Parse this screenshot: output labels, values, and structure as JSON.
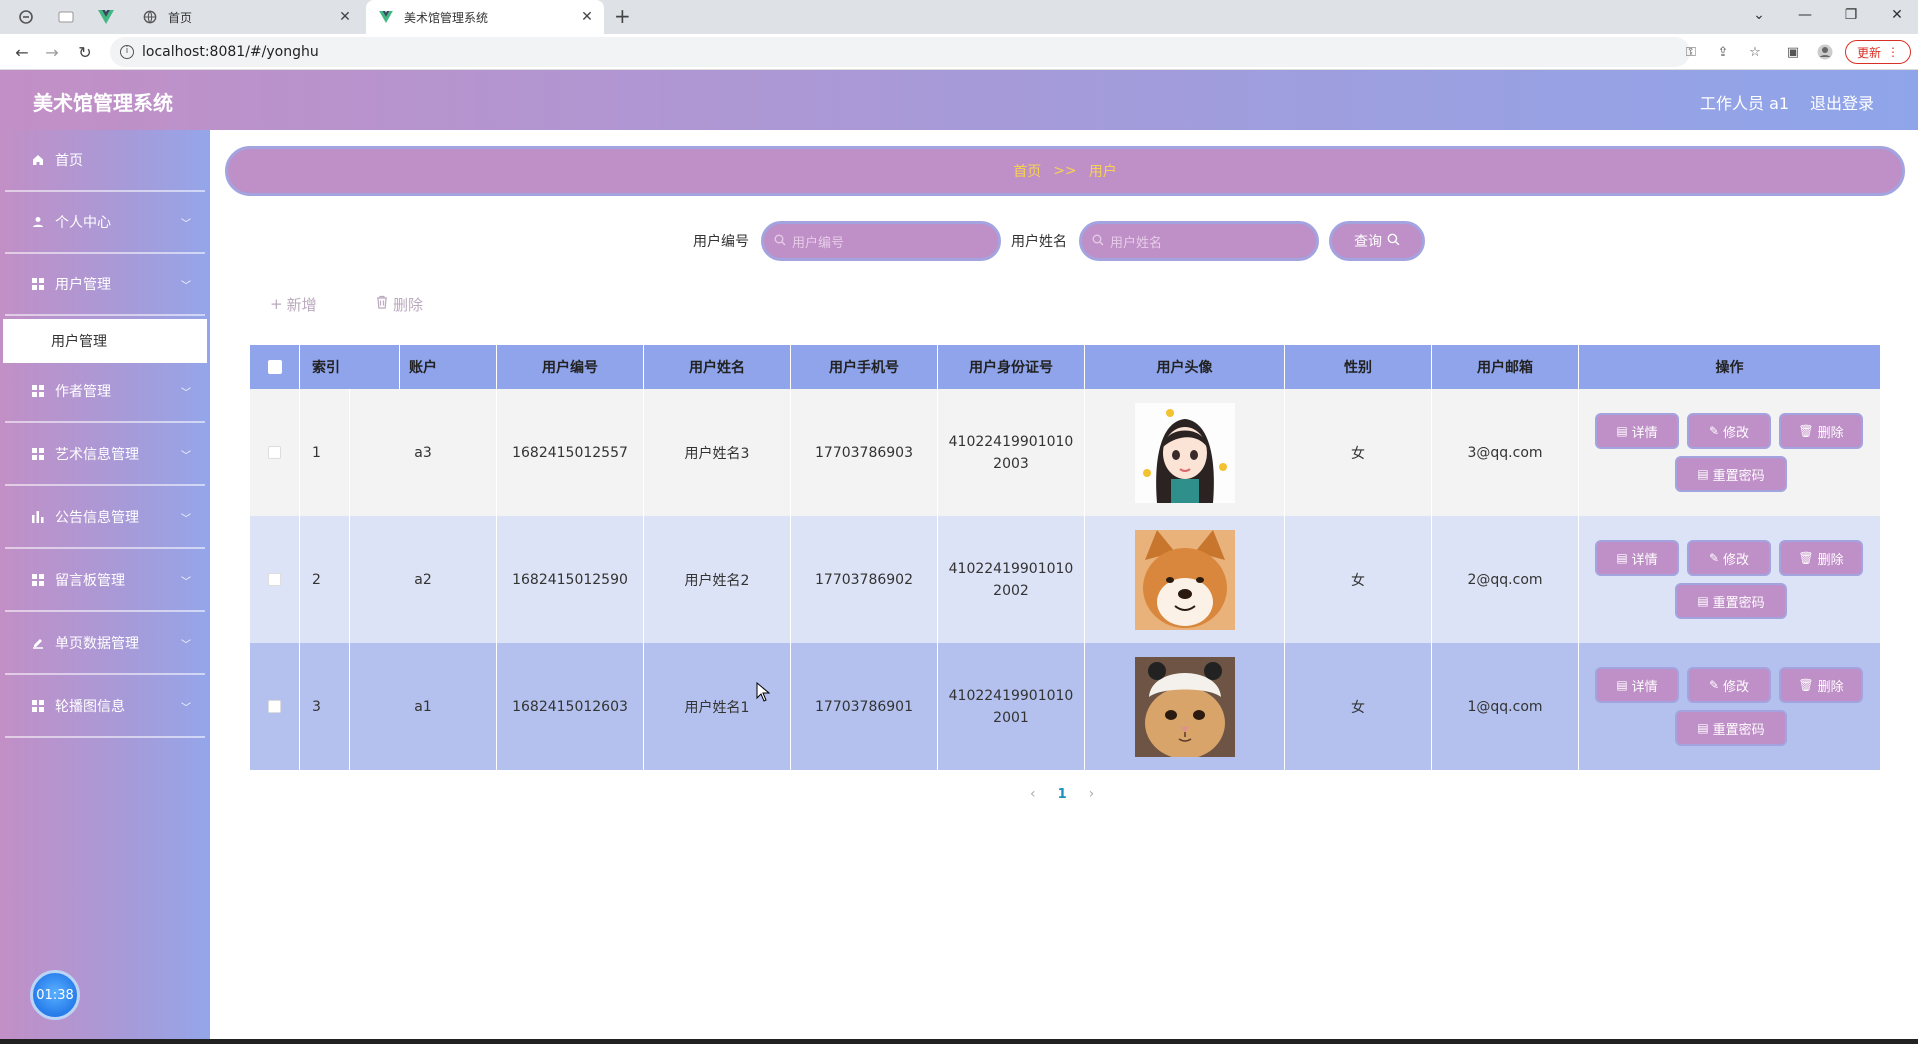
{
  "browser": {
    "tabs": [
      {
        "title": "首页",
        "active": false
      },
      {
        "title": "美术馆管理系统",
        "active": true
      }
    ],
    "url": "localhost:8081/#/yonghu",
    "update_label": "更新"
  },
  "app": {
    "title": "美术馆管理系统",
    "user_label": "工作人员 a1",
    "logout_label": "退出登录"
  },
  "sidebar": {
    "items": [
      {
        "label": "首页",
        "icon": "home-icon",
        "has_arrow": false
      },
      {
        "label": "个人中心",
        "icon": "user-icon",
        "has_arrow": true
      },
      {
        "label": "用户管理",
        "icon": "grid-icon",
        "has_arrow": true
      },
      {
        "label": "作者管理",
        "icon": "grid-icon",
        "has_arrow": true
      },
      {
        "label": "艺术信息管理",
        "icon": "grid-icon",
        "has_arrow": true
      },
      {
        "label": "公告信息管理",
        "icon": "chart-icon",
        "has_arrow": true
      },
      {
        "label": "留言板管理",
        "icon": "grid-icon",
        "has_arrow": true
      },
      {
        "label": "单页数据管理",
        "icon": "edit-icon",
        "has_arrow": true
      },
      {
        "label": "轮播图信息",
        "icon": "grid-icon",
        "has_arrow": true
      }
    ],
    "active_submenu": "用户管理",
    "timer": "01:38"
  },
  "breadcrumb": {
    "home": "首页",
    "separator": ">>",
    "current": "用户"
  },
  "search": {
    "user_no_label": "用户编号",
    "user_no_placeholder": "用户编号",
    "user_name_label": "用户姓名",
    "user_name_placeholder": "用户姓名",
    "query_label": "查询"
  },
  "actions": {
    "add_label": "新增",
    "delete_label": "删除"
  },
  "table": {
    "columns": [
      "索引",
      "账户",
      "用户编号",
      "用户姓名",
      "用户手机号",
      "用户身份证号",
      "用户头像",
      "性别",
      "用户邮箱",
      "操作"
    ],
    "rows": [
      {
        "index": "1",
        "account": "a3",
        "user_no": "1682415012557",
        "name": "用户姓名3",
        "phone": "17703786903",
        "id_card": "410224199010102003",
        "avatar": "girl-avatar",
        "gender": "女",
        "email": "3@qq.com"
      },
      {
        "index": "2",
        "account": "a2",
        "user_no": "1682415012590",
        "name": "用户姓名2",
        "phone": "17703786902",
        "id_card": "410224199010102002",
        "avatar": "shiba-avatar",
        "gender": "女",
        "email": "2@qq.com"
      },
      {
        "index": "3",
        "account": "a1",
        "user_no": "1682415012603",
        "name": "用户姓名1",
        "phone": "17703786901",
        "id_card": "410224199010102001",
        "avatar": "cat-avatar",
        "gender": "女",
        "email": "1@qq.com"
      }
    ],
    "row_actions": {
      "detail": "详情",
      "edit": "修改",
      "delete": "删除",
      "reset_password": "重置密码"
    }
  },
  "pagination": {
    "current_page": "1"
  },
  "colors": {
    "accent_purple": "#bf8fc7",
    "accent_border": "#a3a3e0",
    "header_blue": "#8fa4ea",
    "breadcrumb_text": "#f7d24f"
  }
}
